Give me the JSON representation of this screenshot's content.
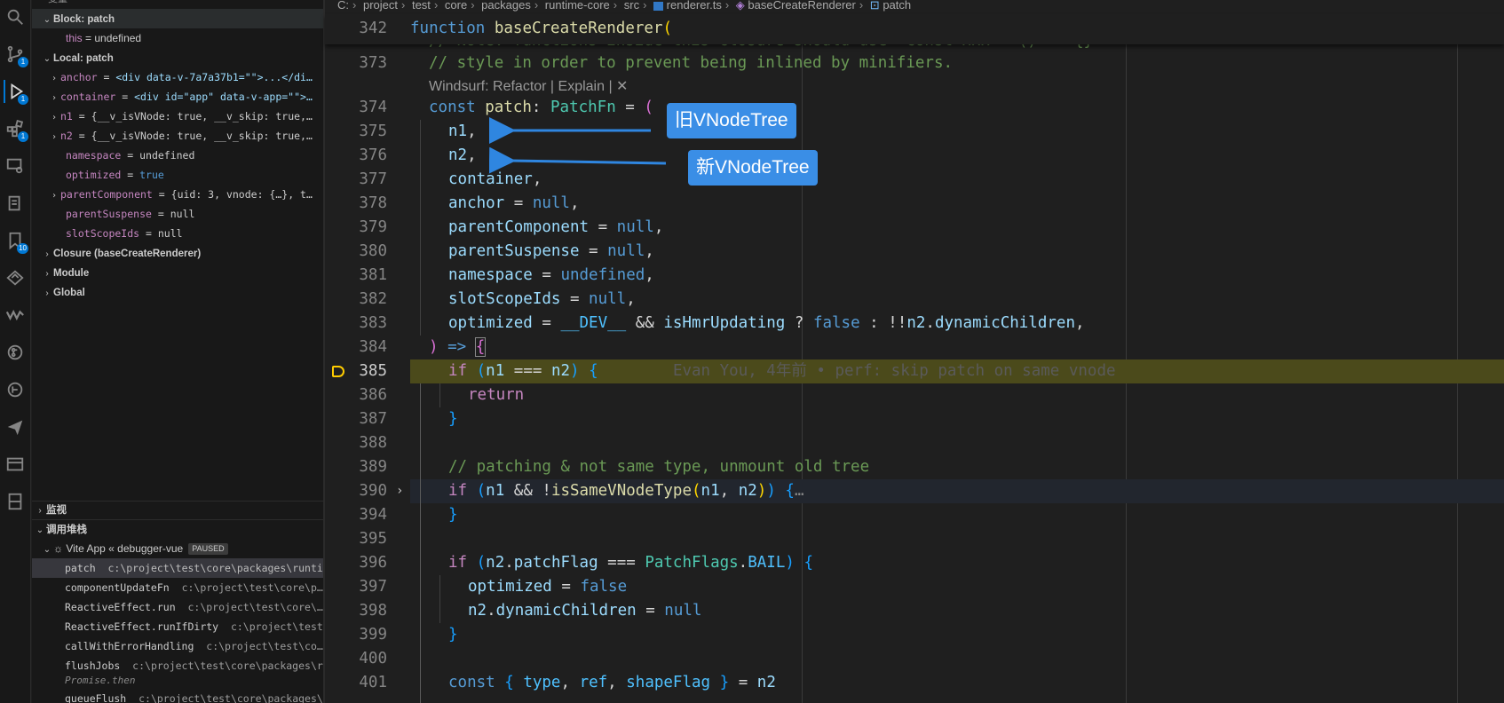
{
  "side": {
    "top_label": "变量",
    "block_header": "Block: patch",
    "this_row": {
      "name": "this",
      "value": "undefined"
    },
    "local_header": "Local: patch",
    "locals": [
      {
        "name": "anchor",
        "value": "<div data-v-7a7a37b1=\"\">...</di…"
      },
      {
        "name": "container",
        "value": "<div id=\"app\" data-v-app=\"\">…"
      },
      {
        "name": "n1",
        "value": "{__v_isVNode: true, __v_skip: true,…"
      },
      {
        "name": "n2",
        "value": "{__v_isVNode: true, __v_skip: true,…"
      },
      {
        "name": "namespace",
        "value": "undefined"
      },
      {
        "name": "optimized",
        "value": "true"
      },
      {
        "name": "parentComponent",
        "value": "{uid: 3, vnode: {…}, t…"
      },
      {
        "name": "parentSuspense",
        "value": "null"
      },
      {
        "name": "slotScopeIds",
        "value": "null"
      }
    ],
    "closure": "Closure (baseCreateRenderer)",
    "module": "Module",
    "global": "Global",
    "watch_label": "监视",
    "callstack_label": "调用堆栈",
    "session": "Vite App « debugger-vue",
    "paused": "PAUSED",
    "frames": [
      {
        "fn": "patch",
        "path": "c:\\project\\test\\core\\packages\\runtim…"
      },
      {
        "fn": "componentUpdateFn",
        "path": "c:\\project\\test\\core\\p…"
      },
      {
        "fn": "ReactiveEffect.run",
        "path": "c:\\project\\test\\core\\…"
      },
      {
        "fn": "ReactiveEffect.runIfDirty",
        "path": "c:\\project\\test\\te…"
      },
      {
        "fn": "callWithErrorHandling",
        "path": "c:\\project\\test\\co…"
      },
      {
        "fn": "flushJobs",
        "path": "c:\\project\\test\\core\\packages\\r…"
      },
      {
        "fn": "Promise.then",
        "path": ""
      },
      {
        "fn": "queueFlush",
        "path": "c:\\project\\test\\core\\packages\\…"
      }
    ]
  },
  "breadcrumbs": [
    "C:",
    "project",
    "test",
    "core",
    "packages",
    "runtime-core",
    "src",
    "renderer.ts",
    "baseCreateRenderer",
    "patch"
  ],
  "badges": {
    "debug": "1",
    "extensions": "1",
    "bookmarks": "10",
    "source_control": "1"
  },
  "editor": {
    "sticky_num": "342",
    "sticky_kw": "function",
    "sticky_fn": "baseCreateRenderer",
    "sticky_paren": "(",
    "l372": "// Note: functions inside this closure should use `const xxx = () => {}`",
    "l373n": "373",
    "l373": "// style in order to prevent being inlined by minifiers.",
    "codelens": "Windsurf: Refactor | Explain | ✕",
    "l374n": "374",
    "l375n": "375",
    "l376n": "376",
    "l377n": "377",
    "l378n": "378",
    "l379n": "379",
    "l380n": "380",
    "l381n": "381",
    "l382n": "382",
    "l383n": "383",
    "l384n": "384",
    "l385n": "385",
    "l386n": "386",
    "l387n": "387",
    "l388n": "388",
    "l389n": "389",
    "l390n": "390",
    "l394n": "394",
    "l395n": "395",
    "l396n": "396",
    "l397n": "397",
    "l398n": "398",
    "l399n": "399",
    "l400n": "400",
    "l401n": "401",
    "blame": "Evan You, 4年前 • perf: skip patch on same vnode",
    "l389": "// patching & not same type, unmount old tree",
    "fold": "…"
  },
  "callouts": {
    "old": "旧VNodeTree",
    "new": "新VNodeTree"
  }
}
